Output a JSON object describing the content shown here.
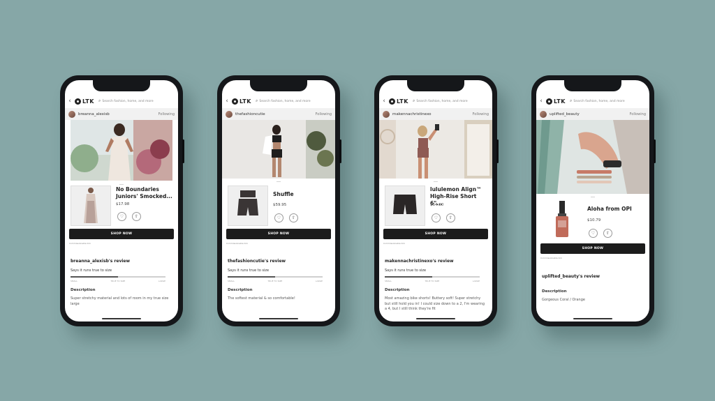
{
  "app": {
    "logo": "LTK",
    "search_placeholder": "Search fashion, home, and more",
    "back_icon": "chevron-left-icon",
    "search_icon": "search-icon",
    "follow_label": "Following",
    "shop_label": "SHOP NOW",
    "commission_note": "Commissionable link",
    "says_label": "Says it runs true to size",
    "size_small": "SMALL",
    "size_true": "TRUE TO SIZE",
    "size_large": "LARGE",
    "description_label": "Description"
  },
  "screens": [
    {
      "user": "breanna_alexisb",
      "product": "No Boundaries Juniors' Smocked...",
      "price": "$17.98",
      "review_title": "breanna_alexisb's review",
      "description": "Super stretchy material and lots of room in my true size large"
    },
    {
      "user": "thefashioncutie",
      "product": "Shuffle",
      "price": "$59.95",
      "review_title": "thefashioncutie's review",
      "description": "The softest material & so comfortable!"
    },
    {
      "user": "makennachristinexo",
      "product": "lululemon Align™ High-Rise Short 6\"...",
      "price": "$64.00",
      "review_title": "makennachristinexo's review",
      "description": "Most amazing bike shorts! Buttery soft! Super stretchy but still hold you in! I could size down to a 2, I'm wearing a 4, but I still think they're fit"
    },
    {
      "user": "uplifted_beauty",
      "product": "Aloha from OPI",
      "price": "$10.79",
      "review_title": "uplifted_beauty's review",
      "description": "Gorgeous Coral / Orange"
    }
  ],
  "colors": {
    "background": "#86a7a7",
    "button": "#1c1c1c"
  }
}
